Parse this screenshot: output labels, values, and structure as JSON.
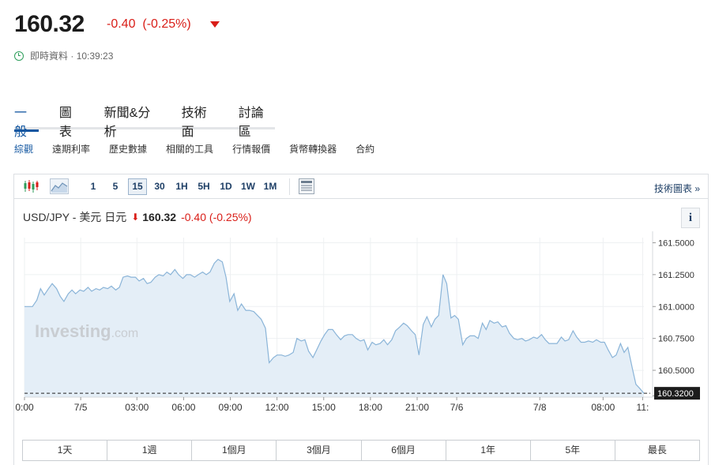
{
  "quote": {
    "price": "160.32",
    "change": "-0.40",
    "change_pct": "(-0.25%)",
    "live_label": "即時資料",
    "time": "· 10:39:23"
  },
  "main_tabs": [
    {
      "label": "一般",
      "active": true
    },
    {
      "label": "圖表"
    },
    {
      "label": "新聞&分析"
    },
    {
      "label": "技術面"
    },
    {
      "label": "討論區"
    }
  ],
  "sub_tabs": [
    {
      "label": "綜觀",
      "active": true
    },
    {
      "label": "遠期利率"
    },
    {
      "label": "歷史數據"
    },
    {
      "label": "相關的工具"
    },
    {
      "label": "行情報價"
    },
    {
      "label": "貨幣轉換器"
    },
    {
      "label": "合約"
    }
  ],
  "toolbar": {
    "intervals": [
      {
        "label": "1"
      },
      {
        "label": "5"
      },
      {
        "label": "15",
        "active": true
      },
      {
        "label": "30"
      },
      {
        "label": "1H"
      },
      {
        "label": "5H"
      },
      {
        "label": "1D"
      },
      {
        "label": "1W"
      },
      {
        "label": "1M"
      }
    ],
    "tech_chart_link": "技術圖表 »"
  },
  "chart_header": {
    "pair": "USD/JPY - 美元 日元",
    "price": "160.32",
    "change": "-0.40",
    "change_pct": "(-0.25%)",
    "info": "i"
  },
  "watermark": {
    "brand": "Investing",
    "suffix": ".com"
  },
  "chart_data": {
    "type": "area",
    "title": "",
    "xlabel": "",
    "ylabel": "",
    "ylim": [
      160.29,
      161.54
    ],
    "yticks": [
      161.5,
      161.25,
      161.0,
      160.75,
      160.5,
      160.3
    ],
    "ytick_labels": [
      "161.5000",
      "161.2500",
      "161.0000",
      "160.7500",
      "160.5000",
      "160.3000"
    ],
    "current_value": 160.32,
    "current_label": "160.3200",
    "xlim": [
      0,
      100.5
    ],
    "xticks": [
      {
        "x": 0,
        "label": "0:00"
      },
      {
        "x": 9.12,
        "label": "7/5"
      },
      {
        "x": 18.24,
        "label": "03:00"
      },
      {
        "x": 25.82,
        "label": "06:00"
      },
      {
        "x": 33.4,
        "label": "09:00"
      },
      {
        "x": 40.97,
        "label": "12:00"
      },
      {
        "x": 48.55,
        "label": "15:00"
      },
      {
        "x": 56.13,
        "label": "18:00"
      },
      {
        "x": 63.71,
        "label": "21:00"
      },
      {
        "x": 70.13,
        "label": "7/6"
      },
      {
        "x": 83.61,
        "label": "7/8"
      },
      {
        "x": 93.88,
        "label": "08:00"
      },
      {
        "x": 100.3,
        "label": "11:"
      }
    ],
    "grid": true,
    "legend": "none",
    "line_color": "#8ab4d8",
    "fill_color": "#e4eef7",
    "points": [
      [
        0,
        161.0
      ],
      [
        1.3,
        161.0
      ],
      [
        2.0,
        161.05
      ],
      [
        2.6,
        161.14
      ],
      [
        3.2,
        161.09
      ],
      [
        3.9,
        161.14
      ],
      [
        4.5,
        161.18
      ],
      [
        5.2,
        161.14
      ],
      [
        5.8,
        161.08
      ],
      [
        6.4,
        161.04
      ],
      [
        7.1,
        161.1
      ],
      [
        7.7,
        161.13
      ],
      [
        8.3,
        161.1
      ],
      [
        9.0,
        161.13
      ],
      [
        9.6,
        161.12
      ],
      [
        10.3,
        161.15
      ],
      [
        10.9,
        161.12
      ],
      [
        11.6,
        161.14
      ],
      [
        12.2,
        161.13
      ],
      [
        12.8,
        161.15
      ],
      [
        13.5,
        161.14
      ],
      [
        14.1,
        161.16
      ],
      [
        14.8,
        161.13
      ],
      [
        15.4,
        161.15
      ],
      [
        16.0,
        161.23
      ],
      [
        16.7,
        161.24
      ],
      [
        17.3,
        161.23
      ],
      [
        18.0,
        161.23
      ],
      [
        18.6,
        161.2
      ],
      [
        19.3,
        161.22
      ],
      [
        19.9,
        161.18
      ],
      [
        20.5,
        161.19
      ],
      [
        21.2,
        161.23
      ],
      [
        21.8,
        161.25
      ],
      [
        22.5,
        161.24
      ],
      [
        23.1,
        161.27
      ],
      [
        23.7,
        161.25
      ],
      [
        24.4,
        161.29
      ],
      [
        25.0,
        161.25
      ],
      [
        25.7,
        161.22
      ],
      [
        26.3,
        161.25
      ],
      [
        26.9,
        161.25
      ],
      [
        27.6,
        161.23
      ],
      [
        28.2,
        161.25
      ],
      [
        28.9,
        161.27
      ],
      [
        29.5,
        161.25
      ],
      [
        30.1,
        161.27
      ],
      [
        30.8,
        161.34
      ],
      [
        31.4,
        161.37
      ],
      [
        32.1,
        161.35
      ],
      [
        32.7,
        161.23
      ],
      [
        33.3,
        161.04
      ],
      [
        34.0,
        161.1
      ],
      [
        34.6,
        160.97
      ],
      [
        35.2,
        161.02
      ],
      [
        35.9,
        160.97
      ],
      [
        36.5,
        160.97
      ],
      [
        37.2,
        160.96
      ],
      [
        37.8,
        160.93
      ],
      [
        38.4,
        160.9
      ],
      [
        39.1,
        160.83
      ],
      [
        39.7,
        160.56
      ],
      [
        40.4,
        160.6
      ],
      [
        41.0,
        160.62
      ],
      [
        41.7,
        160.62
      ],
      [
        42.3,
        160.61
      ],
      [
        42.9,
        160.62
      ],
      [
        43.6,
        160.64
      ],
      [
        44.2,
        160.75
      ],
      [
        44.9,
        160.73
      ],
      [
        45.5,
        160.74
      ],
      [
        46.1,
        160.65
      ],
      [
        46.8,
        160.6
      ],
      [
        47.4,
        160.66
      ],
      [
        48.1,
        160.73
      ],
      [
        48.7,
        160.78
      ],
      [
        49.3,
        160.82
      ],
      [
        50.0,
        160.82
      ],
      [
        50.6,
        160.78
      ],
      [
        51.3,
        160.74
      ],
      [
        51.9,
        160.77
      ],
      [
        52.5,
        160.78
      ],
      [
        53.2,
        160.78
      ],
      [
        53.8,
        160.75
      ],
      [
        54.5,
        160.73
      ],
      [
        55.1,
        160.74
      ],
      [
        55.7,
        160.66
      ],
      [
        56.4,
        160.72
      ],
      [
        57.0,
        160.7
      ],
      [
        57.7,
        160.71
      ],
      [
        58.3,
        160.74
      ],
      [
        58.9,
        160.7
      ],
      [
        59.6,
        160.74
      ],
      [
        60.2,
        160.81
      ],
      [
        60.9,
        160.84
      ],
      [
        61.5,
        160.87
      ],
      [
        62.1,
        160.85
      ],
      [
        62.8,
        160.81
      ],
      [
        63.4,
        160.78
      ],
      [
        64.0,
        160.62
      ],
      [
        64.7,
        160.86
      ],
      [
        65.3,
        160.92
      ],
      [
        66.0,
        160.84
      ],
      [
        66.6,
        160.9
      ],
      [
        67.2,
        160.93
      ],
      [
        67.9,
        161.25
      ],
      [
        68.5,
        161.18
      ],
      [
        69.2,
        160.91
      ],
      [
        69.8,
        160.93
      ],
      [
        70.4,
        160.9
      ],
      [
        71.1,
        160.7
      ],
      [
        71.7,
        160.75
      ],
      [
        72.3,
        160.77
      ],
      [
        73.0,
        160.77
      ],
      [
        73.6,
        160.75
      ],
      [
        74.3,
        160.87
      ],
      [
        74.9,
        160.82
      ],
      [
        75.5,
        160.89
      ],
      [
        76.2,
        160.87
      ],
      [
        76.8,
        160.88
      ],
      [
        77.5,
        160.84
      ],
      [
        78.1,
        160.85
      ],
      [
        78.7,
        160.79
      ],
      [
        79.4,
        160.75
      ],
      [
        80.0,
        160.74
      ],
      [
        80.7,
        160.75
      ],
      [
        81.3,
        160.73
      ],
      [
        81.9,
        160.74
      ],
      [
        82.6,
        160.76
      ],
      [
        83.2,
        160.75
      ],
      [
        83.9,
        160.78
      ],
      [
        84.5,
        160.74
      ],
      [
        85.1,
        160.71
      ],
      [
        85.8,
        160.71
      ],
      [
        86.4,
        160.71
      ],
      [
        87.1,
        160.76
      ],
      [
        87.7,
        160.73
      ],
      [
        88.3,
        160.74
      ],
      [
        89.0,
        160.81
      ],
      [
        89.6,
        160.76
      ],
      [
        90.3,
        160.72
      ],
      [
        90.9,
        160.72
      ],
      [
        91.5,
        160.73
      ],
      [
        92.2,
        160.72
      ],
      [
        92.8,
        160.74
      ],
      [
        93.5,
        160.72
      ],
      [
        94.1,
        160.72
      ],
      [
        94.7,
        160.66
      ],
      [
        95.4,
        160.6
      ],
      [
        96.0,
        160.62
      ],
      [
        96.7,
        160.71
      ],
      [
        97.3,
        160.64
      ],
      [
        97.9,
        160.68
      ],
      [
        98.6,
        160.52
      ],
      [
        99.2,
        160.39
      ],
      [
        99.8,
        160.36
      ],
      [
        100.5,
        160.32
      ]
    ]
  },
  "periods": [
    {
      "label": "1天"
    },
    {
      "label": "1週"
    },
    {
      "label": "1個月"
    },
    {
      "label": "3個月"
    },
    {
      "label": "6個月"
    },
    {
      "label": "1年"
    },
    {
      "label": "5年"
    },
    {
      "label": "最長"
    }
  ]
}
